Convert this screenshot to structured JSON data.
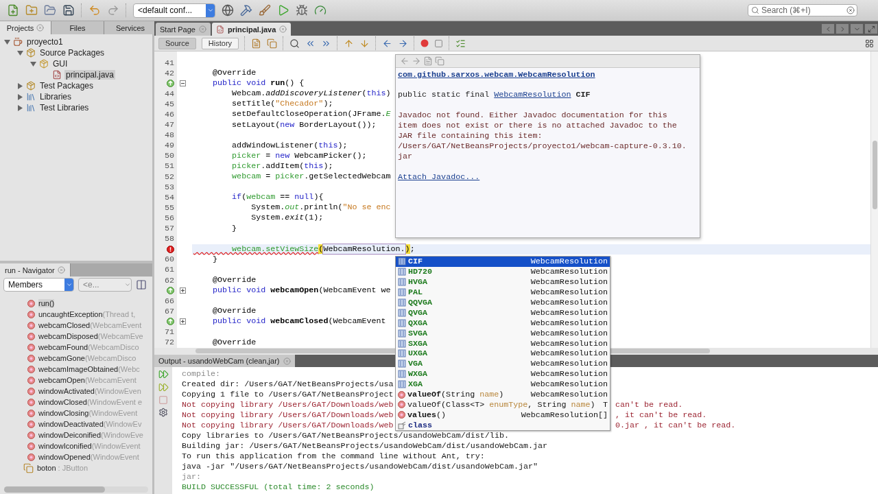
{
  "toolbar": {
    "config": "<default conf...",
    "search_placeholder": "Search (⌘+I)"
  },
  "projects_panel": {
    "tabs": [
      {
        "label": "Projects",
        "selected": true,
        "closable": true
      },
      {
        "label": "Files",
        "selected": false,
        "closable": false
      },
      {
        "label": "Services",
        "selected": false,
        "closable": false
      }
    ],
    "tree": [
      {
        "label": "proyecto1",
        "kind": "project",
        "expanded": true,
        "selected": false,
        "children": [
          {
            "label": "Source Packages",
            "kind": "source-folder",
            "expanded": true,
            "selected": false,
            "children": [
              {
                "label": "GUI",
                "kind": "package",
                "expanded": true,
                "selected": false,
                "children": [
                  {
                    "label": "principal.java",
                    "kind": "java-file",
                    "selected": true
                  }
                ]
              }
            ]
          },
          {
            "label": "Test Packages",
            "kind": "source-folder",
            "expanded": false,
            "selected": false
          },
          {
            "label": "Libraries",
            "kind": "library",
            "expanded": false,
            "selected": false
          },
          {
            "label": "Test Libraries",
            "kind": "library",
            "expanded": false,
            "selected": false
          }
        ]
      }
    ]
  },
  "navigator": {
    "title": "run - Navigator",
    "filter": "Members",
    "second_filter": "<e...",
    "items": [
      {
        "name": "run()",
        "kind": "method",
        "selected": true
      },
      {
        "name": "uncaughtException",
        "params": "(Thread t,",
        "kind": "method",
        "selected": false
      },
      {
        "name": "webcamClosed",
        "params": "(WebcamEvent",
        "kind": "method",
        "selected": false
      },
      {
        "name": "webcamDisposed",
        "params": "(WebcamEve",
        "kind": "method",
        "selected": false
      },
      {
        "name": "webcamFound",
        "params": "(WebcamDisco",
        "kind": "method",
        "selected": false
      },
      {
        "name": "webcamGone",
        "params": "(WebcamDisco",
        "kind": "method",
        "selected": false
      },
      {
        "name": "webcamImageObtained",
        "params": "(Webc",
        "kind": "method",
        "selected": false
      },
      {
        "name": "webcamOpen",
        "params": "(WebcamEvent",
        "kind": "method",
        "selected": false
      },
      {
        "name": "windowActivated",
        "params": "(WindowEven",
        "kind": "method",
        "selected": false
      },
      {
        "name": "windowClosed",
        "params": "(WindowEvent e",
        "kind": "method",
        "selected": false
      },
      {
        "name": "windowClosing",
        "params": "(WindowEvent",
        "kind": "method",
        "selected": false
      },
      {
        "name": "windowDeactivated",
        "params": "(WindowEv",
        "kind": "method",
        "selected": false
      },
      {
        "name": "windowDeiconified",
        "params": "(WindowEve",
        "kind": "method",
        "selected": false
      },
      {
        "name": "windowIconified",
        "params": "(WindowEvent",
        "kind": "method",
        "selected": false
      },
      {
        "name": "windowOpened",
        "params": "(WindowEvent",
        "kind": "method",
        "selected": false
      },
      {
        "name": "boton",
        "params": " : JButton",
        "kind": "field",
        "selected": false
      }
    ]
  },
  "editor": {
    "tabs": [
      {
        "label": "Start Page",
        "selected": false
      },
      {
        "label": "principal.java",
        "selected": true
      }
    ],
    "views": [
      {
        "label": "Source",
        "selected": true
      },
      {
        "label": "History",
        "selected": false
      }
    ],
    "lines": [
      {
        "kind": "code",
        "number": "41"
      },
      {
        "kind": "code",
        "number": "42",
        "tokens": [
          {
            "text": "    @Override",
            "kind": "plain"
          }
        ]
      },
      {
        "kind": "override",
        "folded": false,
        "tokens": [
          {
            "text": "    public",
            "kind": "kw"
          },
          {
            "text": " void",
            "kind": "kw"
          },
          {
            "text": " run",
            "kind": "bold"
          },
          {
            "text": "() {",
            "kind": "plain"
          }
        ]
      },
      {
        "kind": "code",
        "number": "44",
        "tokens": [
          {
            "text": "        Webcam.",
            "kind": "plain"
          },
          {
            "text": "addDiscoveryListener",
            "kind": "italic"
          },
          {
            "text": "(",
            "kind": "plain"
          },
          {
            "text": "this",
            "kind": "kw"
          },
          {
            "text": ")",
            "kind": "plain"
          }
        ]
      },
      {
        "kind": "code",
        "number": "45",
        "tokens": [
          {
            "text": "        setTitle(",
            "kind": "plain"
          },
          {
            "text": "\"Checador\"",
            "kind": "str"
          },
          {
            "text": ");",
            "kind": "plain"
          }
        ]
      },
      {
        "kind": "code",
        "number": "46",
        "tokens": [
          {
            "text": "        setDefaultCloseOperation(JFrame.",
            "kind": "plain"
          },
          {
            "text": "E",
            "kind": "static"
          }
        ]
      },
      {
        "kind": "code",
        "number": "47",
        "tokens": [
          {
            "text": "        setLayout(",
            "kind": "plain"
          },
          {
            "text": "new",
            "kind": "kw"
          },
          {
            "text": " BorderLayout());",
            "kind": "plain"
          }
        ]
      },
      {
        "kind": "code",
        "number": "48"
      },
      {
        "kind": "code",
        "number": "49",
        "tokens": [
          {
            "text": "        addWindowListener(",
            "kind": "plain"
          },
          {
            "text": "this",
            "kind": "kw"
          },
          {
            "text": ");",
            "kind": "plain"
          }
        ]
      },
      {
        "kind": "code",
        "number": "50",
        "tokens": [
          {
            "text": "        picker",
            "kind": "field"
          },
          {
            "text": " = ",
            "kind": "plain"
          },
          {
            "text": "new",
            "kind": "kw"
          },
          {
            "text": " WebcamPicker();",
            "kind": "plain"
          }
        ]
      },
      {
        "kind": "code",
        "number": "51",
        "tokens": [
          {
            "text": "        picker",
            "kind": "field"
          },
          {
            "text": ".addItem(",
            "kind": "plain"
          },
          {
            "text": "this",
            "kind": "kw"
          },
          {
            "text": ");",
            "kind": "plain"
          }
        ]
      },
      {
        "kind": "code",
        "number": "52",
        "tokens": [
          {
            "text": "        webcam",
            "kind": "field"
          },
          {
            "text": " = ",
            "kind": "plain"
          },
          {
            "text": "picker",
            "kind": "field"
          },
          {
            "text": ".getSelectedWebcam",
            "kind": "plain"
          }
        ]
      },
      {
        "kind": "code",
        "number": "53"
      },
      {
        "kind": "code",
        "number": "54",
        "tokens": [
          {
            "text": "        if",
            "kind": "kw"
          },
          {
            "text": "(",
            "kind": "plain"
          },
          {
            "text": "webcam",
            "kind": "field"
          },
          {
            "text": " == ",
            "kind": "plain"
          },
          {
            "text": "null",
            "kind": "kw"
          },
          {
            "text": "){",
            "kind": "plain"
          }
        ]
      },
      {
        "kind": "code",
        "number": "55",
        "tokens": [
          {
            "text": "            System.",
            "kind": "plain"
          },
          {
            "text": "out",
            "kind": "static"
          },
          {
            "text": ".println(",
            "kind": "plain"
          },
          {
            "text": "\"No se enc",
            "kind": "str"
          }
        ]
      },
      {
        "kind": "code",
        "number": "56",
        "tokens": [
          {
            "text": "            System.",
            "kind": "plain"
          },
          {
            "text": "exit",
            "kind": "italic"
          },
          {
            "text": "(1);",
            "kind": "plain"
          }
        ]
      },
      {
        "kind": "code",
        "number": "57",
        "tokens": [
          {
            "text": "        }",
            "kind": "plain"
          }
        ]
      },
      {
        "kind": "code",
        "number": "58"
      },
      {
        "kind": "error",
        "current": true,
        "tokens": [
          {
            "text": "        webcam.setViewSize",
            "kind": "error"
          },
          {
            "text": "(",
            "kind": "match"
          },
          {
            "text": "WebcamResolution.",
            "kind": "edit"
          },
          {
            "text": ")",
            "kind": "match"
          },
          {
            "text": ";",
            "kind": "plain"
          }
        ]
      },
      {
        "kind": "code",
        "number": "60",
        "tokens": [
          {
            "text": "    }",
            "kind": "plain"
          }
        ]
      },
      {
        "kind": "code",
        "number": "61"
      },
      {
        "kind": "code",
        "number": "62",
        "tokens": [
          {
            "text": "    @Override",
            "kind": "plain"
          }
        ]
      },
      {
        "kind": "override",
        "folded": true,
        "tokens": [
          {
            "text": "    public",
            "kind": "kw"
          },
          {
            "text": " void",
            "kind": "kw"
          },
          {
            "text": " webcamOpen",
            "kind": "bold"
          },
          {
            "text": "(WebcamEvent we",
            "kind": "plain"
          }
        ]
      },
      {
        "kind": "code",
        "number": "66"
      },
      {
        "kind": "code",
        "number": "67",
        "tokens": [
          {
            "text": "    @Override",
            "kind": "plain"
          }
        ]
      },
      {
        "kind": "override",
        "folded": true,
        "tokens": [
          {
            "text": "    public",
            "kind": "kw"
          },
          {
            "text": " void",
            "kind": "kw"
          },
          {
            "text": " webcamClosed",
            "kind": "bold"
          },
          {
            "text": "(WebcamEvent",
            "kind": "plain"
          }
        ]
      },
      {
        "kind": "code",
        "number": "71"
      },
      {
        "kind": "code",
        "number": "72",
        "tokens": [
          {
            "text": "    @Override",
            "kind": "plain"
          }
        ]
      }
    ]
  },
  "javadoc": {
    "class_link": "com.github.sarxos.webcam.WebcamResolution",
    "signature_prefix": "public static final",
    "signature_link": "WebcamResolution",
    "signature_suffix": "CIF",
    "message": "Javadoc not found. Either Javadoc documentation for this\nitem does not exist or there is no attached Javadoc to the\nJAR file containing this item:\n/Users/GAT/NetBeansProjects/proyecto1/webcam-capture-0.3.10.\njar",
    "attach_link": "Attach Javadoc..."
  },
  "completion": [
    {
      "kind": "constant",
      "name": "CIF",
      "type": "WebcamResolution",
      "selected": true
    },
    {
      "kind": "constant",
      "name": "HD720",
      "type": "WebcamResolution",
      "selected": false
    },
    {
      "kind": "constant",
      "name": "HVGA",
      "type": "WebcamResolution",
      "selected": false
    },
    {
      "kind": "constant",
      "name": "PAL",
      "type": "WebcamResolution",
      "selected": false
    },
    {
      "kind": "constant",
      "name": "QQVGA",
      "type": "WebcamResolution",
      "selected": false
    },
    {
      "kind": "constant",
      "name": "QVGA",
      "type": "WebcamResolution",
      "selected": false
    },
    {
      "kind": "constant",
      "name": "QXGA",
      "type": "WebcamResolution",
      "selected": false
    },
    {
      "kind": "constant",
      "name": "SVGA",
      "type": "WebcamResolution",
      "selected": false
    },
    {
      "kind": "constant",
      "name": "SXGA",
      "type": "WebcamResolution",
      "selected": false
    },
    {
      "kind": "constant",
      "name": "UXGA",
      "type": "WebcamResolution",
      "selected": false
    },
    {
      "kind": "constant",
      "name": "VGA",
      "type": "WebcamResolution",
      "selected": false
    },
    {
      "kind": "constant",
      "name": "WXGA",
      "type": "WebcamResolution",
      "selected": false
    },
    {
      "kind": "constant",
      "name": "XGA",
      "type": "WebcamResolution",
      "selected": false
    },
    {
      "kind": "method",
      "name": "valueOf",
      "bold": true,
      "signature": [
        {
          "text": "(String ",
          "kind": "plain"
        },
        {
          "text": "name",
          "kind": "param"
        },
        {
          "text": ")",
          "kind": "plain"
        }
      ],
      "type": "WebcamResolution",
      "selected": false
    },
    {
      "kind": "method",
      "name": "valueOf",
      "bold": false,
      "signature": [
        {
          "text": "(Class<T> ",
          "kind": "plain"
        },
        {
          "text": "enumType",
          "kind": "param"
        },
        {
          "text": ", String ",
          "kind": "plain"
        },
        {
          "text": "name",
          "kind": "param"
        },
        {
          "text": ")",
          "kind": "plain"
        }
      ],
      "type": "T",
      "selected": false
    },
    {
      "kind": "method",
      "name": "values",
      "bold": true,
      "signature": [
        {
          "text": "()",
          "kind": "plain"
        }
      ],
      "type": "WebcamResolution[]",
      "selected": false
    },
    {
      "kind": "class",
      "name": "class",
      "selected": false
    }
  ],
  "output": {
    "title": "Output - usandoWebCam (clean,jar)",
    "lines": [
      {
        "text": "compile:",
        "kind": "target"
      },
      {
        "text": "Created dir: /Users/GAT/NetBeansProjects/usa",
        "kind": "normal"
      },
      {
        "text": "Copying 1 file to /Users/GAT/NetBeansProject",
        "kind": "normal"
      },
      {
        "text": "Not copying library /Users/GAT/Downloads/web",
        "tail": "can't be read.",
        "kind": "error"
      },
      {
        "text": "Not copying library /Users/GAT/Downloads/web",
        "tail": ", it can't be read.",
        "kind": "error"
      },
      {
        "text": "Not copying library /Users/GAT/Downloads/web",
        "tail": "0.jar , it can't be read.",
        "kind": "error"
      },
      {
        "text": "Copy libraries to /Users/GAT/NetBeansProjects/usandoWebCam/dist/lib.",
        "kind": "normal"
      },
      {
        "text": "Building jar: /Users/GAT/NetBeansProjects/usandoWebCam/dist/usandoWebCam.jar",
        "kind": "normal"
      },
      {
        "text": "To run this application from the command line without Ant, try:",
        "kind": "normal"
      },
      {
        "text": "java -jar \"/Users/GAT/NetBeansProjects/usandoWebCam/dist/usandoWebCam.jar\"",
        "kind": "normal"
      },
      {
        "text": "jar:",
        "kind": "target"
      },
      {
        "text": "BUILD SUCCESSFUL (total time: 2 seconds)",
        "kind": "success"
      }
    ]
  }
}
